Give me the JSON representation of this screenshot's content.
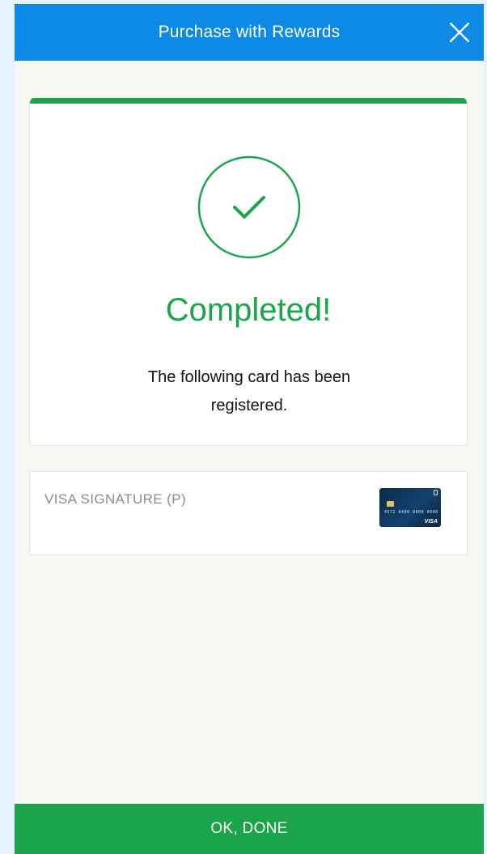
{
  "header": {
    "title": "Purchase with Rewards",
    "close_icon": "close-icon",
    "background_color": "#0d89e6"
  },
  "status": {
    "icon": "checkmark-circle-icon",
    "title": "Completed!",
    "message": "The following card has been registered.",
    "accent_color": "#1ba54a"
  },
  "card": {
    "name": "VISA SIGNATURE (P)",
    "image_number": "4572 0400 0000 0000",
    "image_brand": "VISA",
    "image_icon": "credit-card-icon"
  },
  "footer": {
    "button_label": "OK, DONE",
    "background_color": "#1ba54a"
  }
}
